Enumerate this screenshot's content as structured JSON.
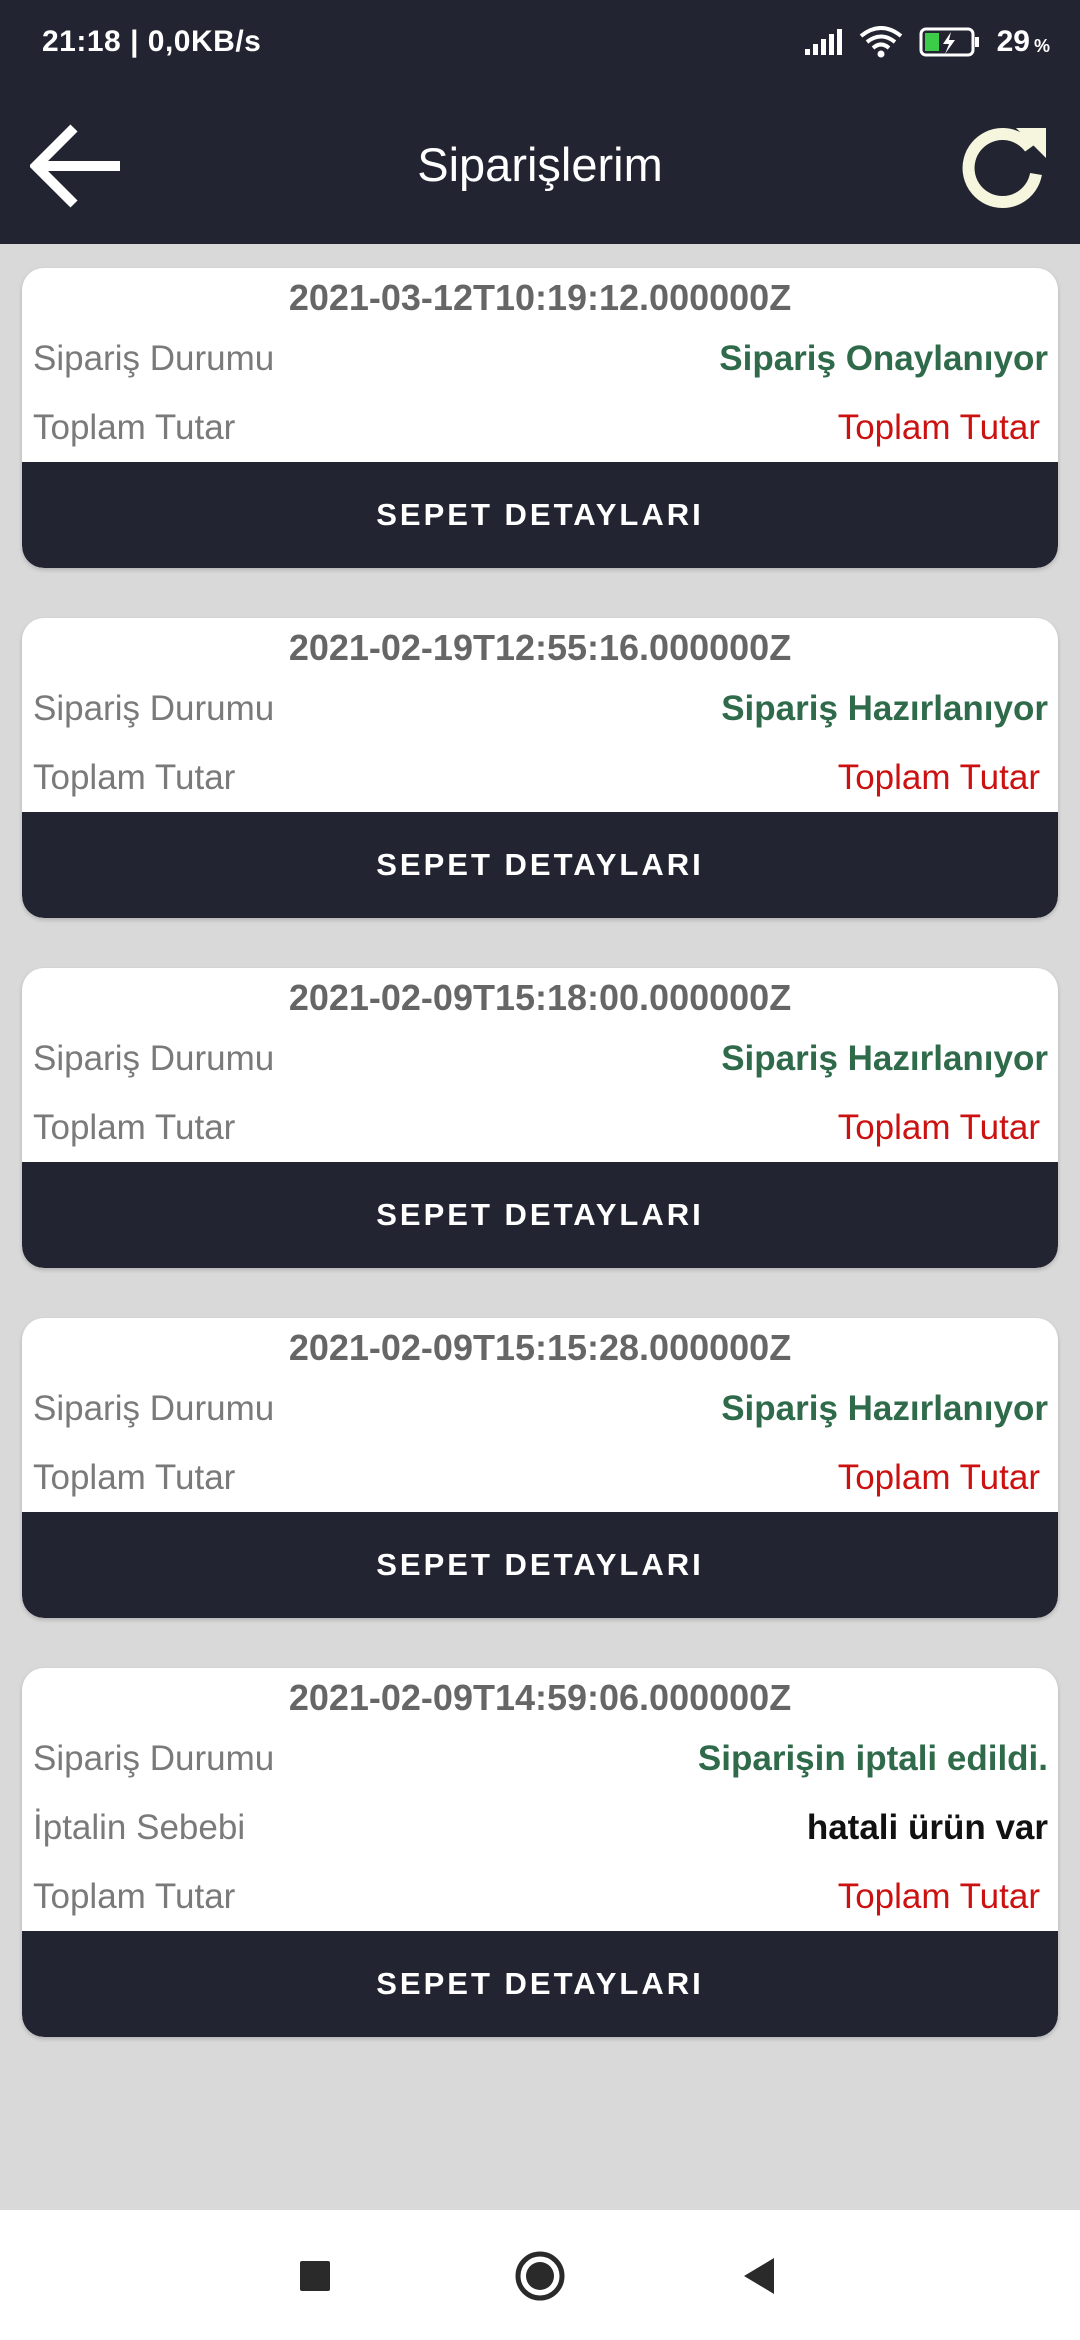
{
  "status_bar": {
    "time_speed": "21:18 | 0,0KB/s",
    "battery_percent": "29",
    "percent_sign": "%"
  },
  "header": {
    "title": "Siparişlerim",
    "back_icon": "arrow-left-icon",
    "refresh_icon": "refresh-icon"
  },
  "orders": [
    {
      "date": "2021-03-12T10:19:12.000000Z",
      "status_label": "Sipariş Durumu",
      "status_value": "Sipariş Onaylanıyor",
      "total_label": "Toplam Tutar",
      "total_value": "Toplam Tutar",
      "button_label": "SEPET DETAYLARI"
    },
    {
      "date": "2021-02-19T12:55:16.000000Z",
      "status_label": "Sipariş Durumu",
      "status_value": "Sipariş Hazırlanıyor",
      "total_label": "Toplam Tutar",
      "total_value": "Toplam Tutar",
      "button_label": "SEPET DETAYLARI"
    },
    {
      "date": "2021-02-09T15:18:00.000000Z",
      "status_label": "Sipariş Durumu",
      "status_value": "Sipariş Hazırlanıyor",
      "total_label": "Toplam Tutar",
      "total_value": "Toplam Tutar",
      "button_label": "SEPET DETAYLARI"
    },
    {
      "date": "2021-02-09T15:15:28.000000Z",
      "status_label": "Sipariş Durumu",
      "status_value": "Sipariş Hazırlanıyor",
      "total_label": "Toplam Tutar",
      "total_value": "Toplam Tutar",
      "button_label": "SEPET DETAYLARI"
    },
    {
      "date": "2021-02-09T14:59:06.000000Z",
      "status_label": "Sipariş Durumu",
      "status_value": "Siparişin iptali edildi.",
      "reason_label": "İptalin Sebebi",
      "reason_value": "hatali ürün var",
      "total_label": "Toplam Tutar",
      "total_value": "Toplam Tutar",
      "button_label": "SEPET DETAYLARI"
    }
  ],
  "colors": {
    "header_bg": "#222432",
    "status_green": "#2f6b4a",
    "total_red": "#cc1111",
    "list_bg": "#d9d9d9"
  },
  "nav_bar": {
    "recents_icon": "square-icon",
    "home_icon": "circle-icon",
    "back_icon": "triangle-back-icon"
  }
}
